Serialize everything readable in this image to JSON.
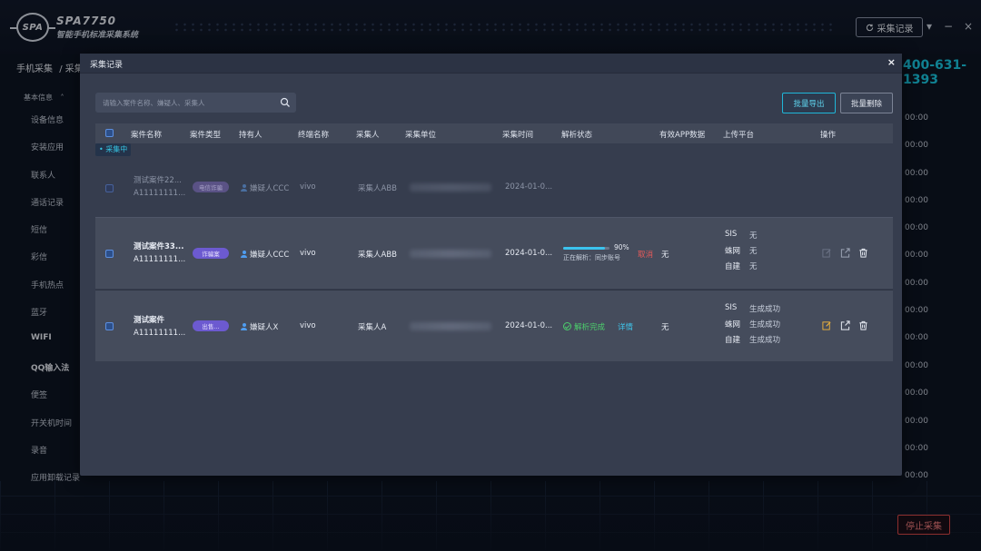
{
  "app": {
    "logo_text": "SPA",
    "name": "SPA7750",
    "subtitle": "智能手机标准采集系统",
    "record_button": "采集记录",
    "hotline": "400-631-1393",
    "breadcrumb_root": "手机采集",
    "breadcrumb_current": "/ 采集"
  },
  "sidebar": {
    "section": "基本信息",
    "items": [
      "设备信息",
      "安装应用",
      "联系人",
      "通话记录",
      "短信",
      "彩信",
      "手机热点",
      "蓝牙",
      "WIFI",
      "QQ输入法",
      "便签",
      "开关机时间",
      "录音",
      "应用卸载记录"
    ]
  },
  "times": [
    "00:00",
    "00:00",
    "00:00",
    "00:00",
    "00:00",
    "00:00",
    "00:00",
    "00:00",
    "00:00",
    "00:00",
    "00:00",
    "00:00",
    "00:00",
    "00:00"
  ],
  "stop_button": "停止采集",
  "modal": {
    "title": "采集记录",
    "close": "×",
    "search_placeholder": "请输入案件名称、嫌疑人、采集人",
    "export_button": "批量导出",
    "delete_button": "批量删除",
    "columns": [
      "案件名称",
      "案件类型",
      "持有人",
      "终端名称",
      "采集人",
      "采集单位",
      "采集时间",
      "解析状态",
      "有效APP数据",
      "上传平台",
      "操作"
    ],
    "collecting_tag": "• 采集中",
    "rows": [
      {
        "case_name": "测试案件22...",
        "case_id": "A11111111...",
        "case_type": "电信诈骗",
        "holder": "嫌疑人CCC",
        "terminal": "vivo",
        "collector": "采集人ABB",
        "time": "2024-01-0..."
      },
      {
        "case_name": "测试案件33...",
        "case_id": "A11111111...",
        "case_type": "诈骗案",
        "holder": "嫌疑人CCC",
        "terminal": "vivo",
        "collector": "采集人ABB",
        "time": "2024-01-0...",
        "progress_percent": 90,
        "progress_label": "90%",
        "parse_text": "正在解析：同步账号",
        "cancel": "取消",
        "valid_app": "无",
        "platforms": [
          {
            "name": "SIS",
            "status": "无"
          },
          {
            "name": "蛛网",
            "status": "无"
          },
          {
            "name": "自建",
            "status": "无"
          }
        ]
      },
      {
        "case_name": "测试案件",
        "case_id": "A11111111...",
        "case_type": "出售...",
        "holder": "嫌疑人X",
        "terminal": "vivo",
        "collector": "采集人A",
        "time": "2024-01-0...",
        "parse_status": "解析完成",
        "detail": "详情",
        "valid_app": "无",
        "platforms": [
          {
            "name": "SIS",
            "status": "生成成功"
          },
          {
            "name": "蛛网",
            "status": "生成成功"
          },
          {
            "name": "自建",
            "status": "生成成功"
          }
        ]
      }
    ]
  },
  "colors": {
    "accent_cyan": "#19c7e0",
    "badge_purple": "#6c5ad0",
    "danger_red": "#e85a5a",
    "success_green": "#4ccf6c"
  }
}
